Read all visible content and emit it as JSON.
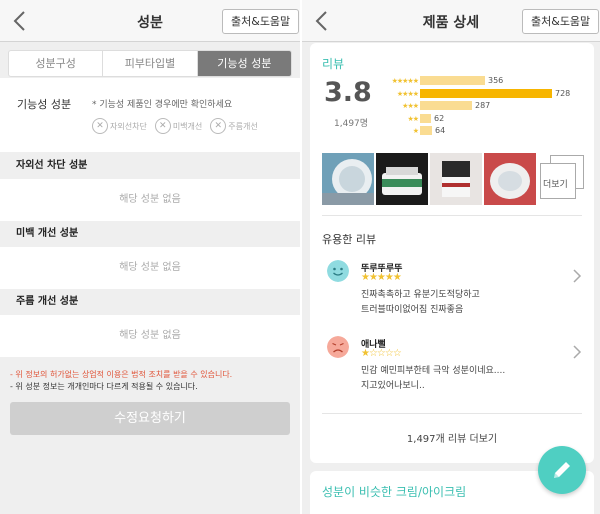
{
  "left": {
    "header": {
      "title": "성분",
      "source_button": "출처&도움말"
    },
    "tabs": [
      {
        "label": "성분구성",
        "active": false
      },
      {
        "label": "피부타입별",
        "active": false
      },
      {
        "label": "기능성 성분",
        "active": true
      }
    ],
    "functional": {
      "label": "기능성 성분",
      "note": "* 기능성 제품인 경우에만 확인하세요",
      "chips": [
        "자외선차단",
        "미백개선",
        "주름개선"
      ]
    },
    "sections": [
      {
        "title": "자외선 차단 성분",
        "value": "해당 성분 없음"
      },
      {
        "title": "미백 개선 성분",
        "value": "해당 성분 없음"
      },
      {
        "title": "주름 개선 성분",
        "value": "해당 성분 없음"
      }
    ],
    "warning_1": "- 위 정보의 허가없는 상업적 이용은 법적 조치를 받을 수 있습니다.",
    "warning_2": "- 위 성분 정보는 개개인마다 다르게 적용될 수 있습니다.",
    "request_button": "수정요청하기"
  },
  "right": {
    "header": {
      "title": "제품 상세",
      "source_button": "출처&도움말"
    },
    "review": {
      "title": "리뷰",
      "average": "3.8",
      "count": "1,497명",
      "distribution": [
        {
          "stars": "★★★★★",
          "count": "356",
          "value": 356
        },
        {
          "stars": "★★★★",
          "count": "728",
          "value": 728
        },
        {
          "stars": "★★★",
          "count": "287",
          "value": 287
        },
        {
          "stars": "★★",
          "count": "62",
          "value": 62
        },
        {
          "stars": "★",
          "count": "64",
          "value": 64
        }
      ],
      "more_photos": "더보기",
      "useful_title": "유용한 리뷰",
      "items": [
        {
          "name": "뚜루뚜루뚜",
          "stars": "★★★★★",
          "rating": 5,
          "line1": "진짜촉촉하고 유분기도적당하고",
          "line2": "트러블따이없어짐 진짜좋음",
          "face": "happy"
        },
        {
          "name": "애나뻘",
          "stars": "★☆☆☆☆",
          "rating": 1,
          "line1": "민감 예민피부한테 극악 성분이네요....",
          "line2": "지고있어나보니..",
          "face": "sad"
        }
      ],
      "more_reviews": "1,497개 리뷰 더보기"
    },
    "similar_title": "성분이 비슷한 크림/아이크림"
  },
  "colors": {
    "accent": "#3bbfb1",
    "star": "#f1c232",
    "bar": "#fadc92",
    "bar_max": "#f7b500",
    "fab": "#4fcfc2"
  }
}
